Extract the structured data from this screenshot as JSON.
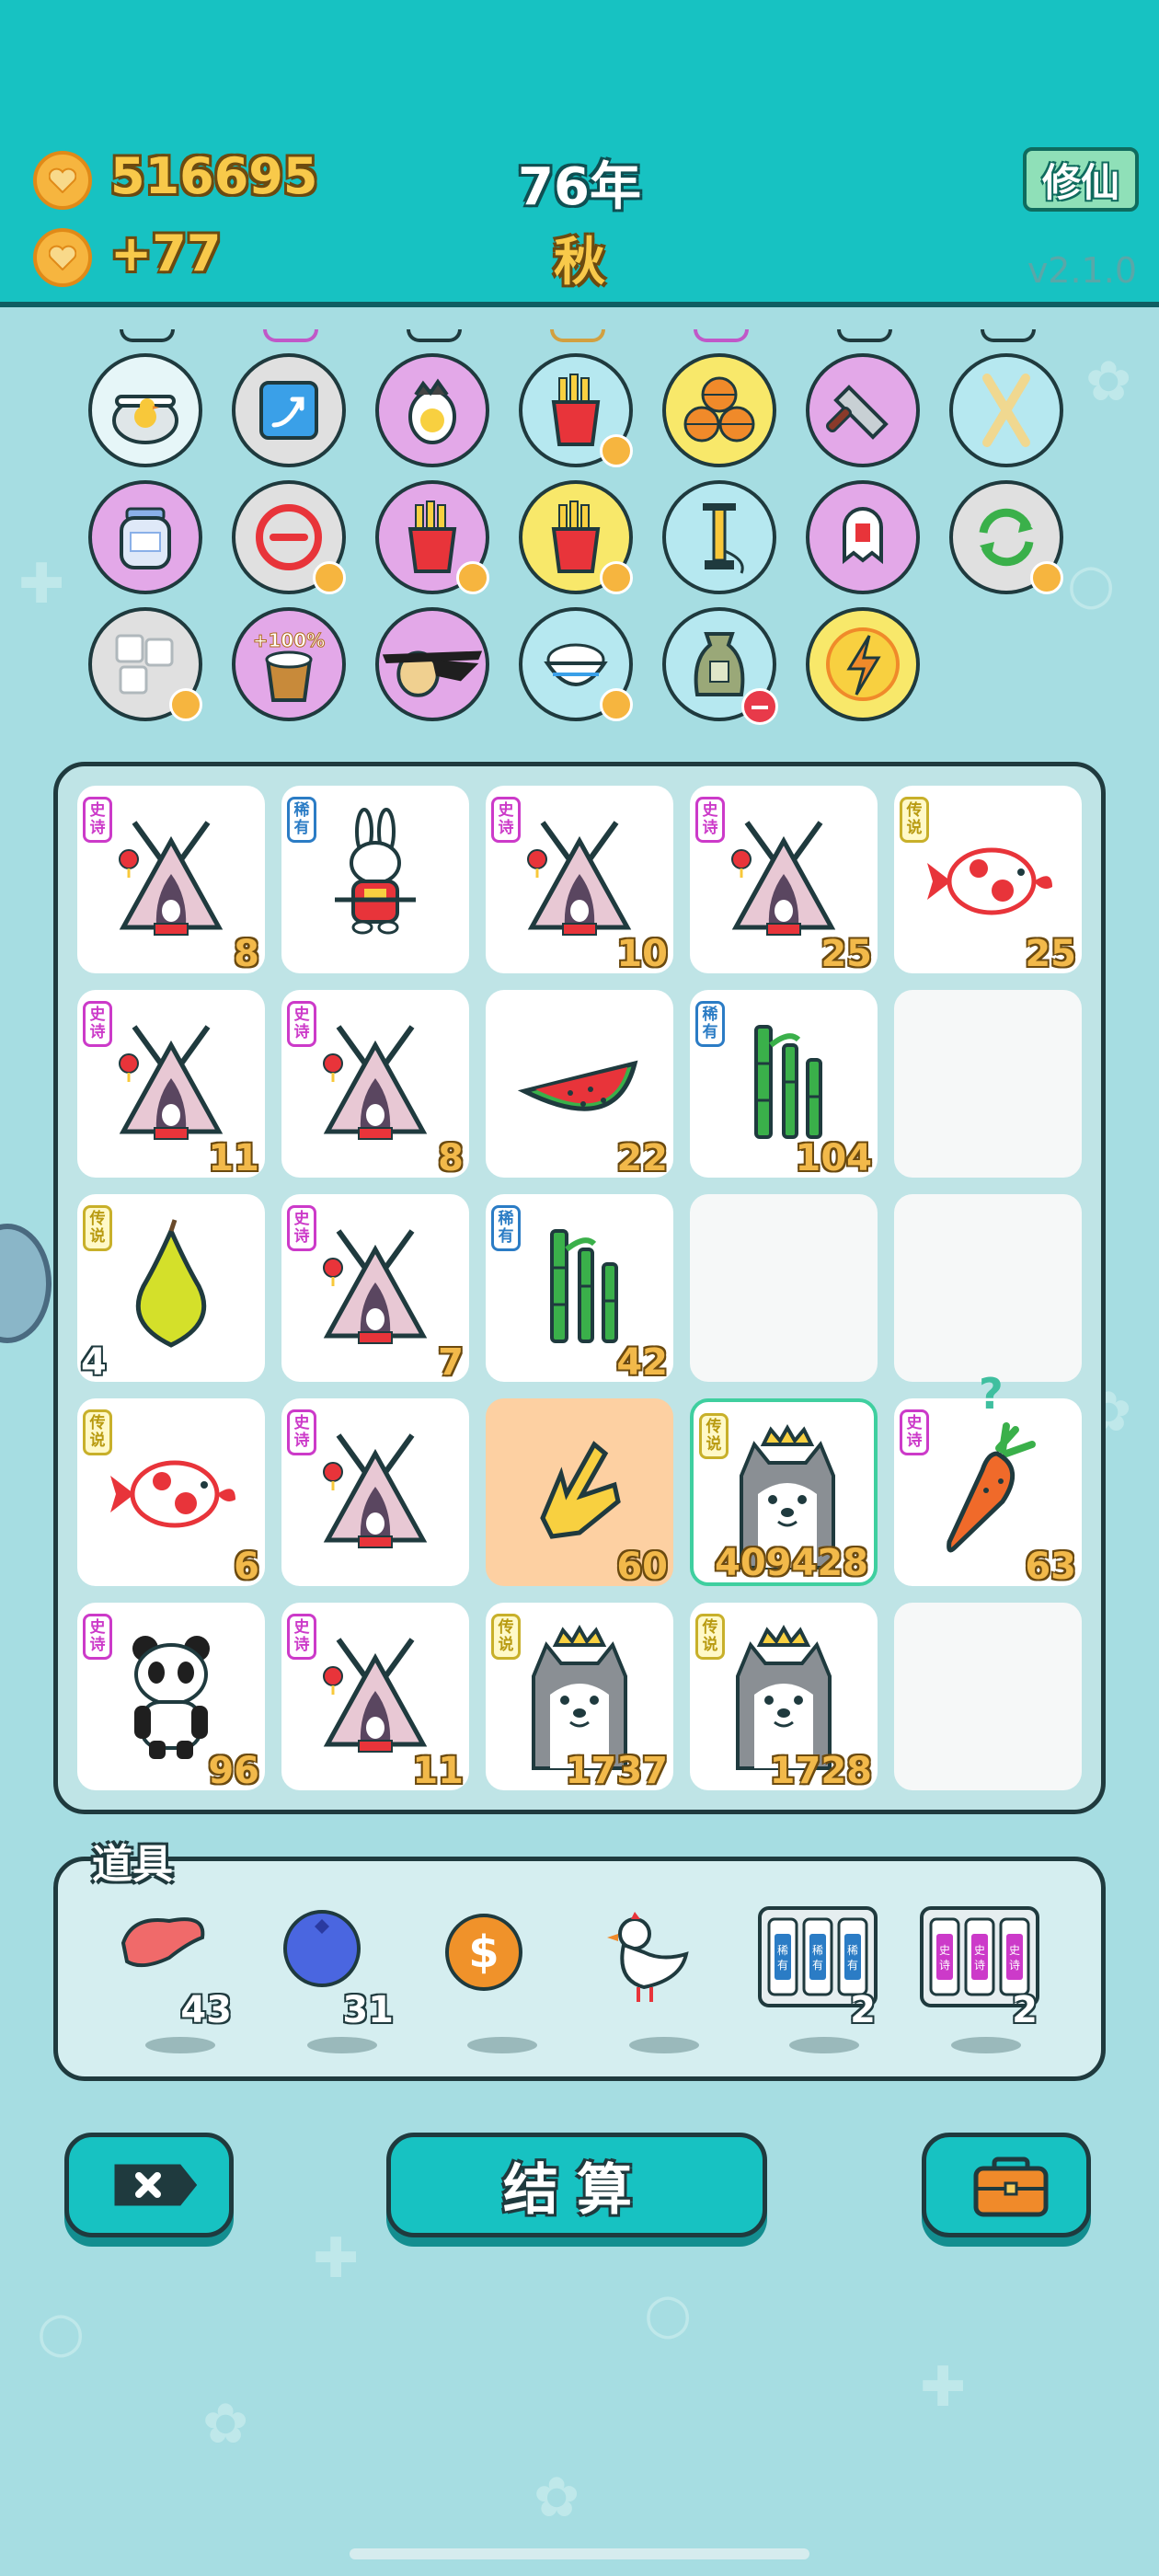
{
  "header": {
    "coins": "516695",
    "income": "+77",
    "year": "76年",
    "season": "秋",
    "mode_button": "修仙",
    "version": "v2.1.0"
  },
  "items": [
    {
      "name": "duck-pot",
      "color": "#e6f6f8",
      "badge": false
    },
    {
      "name": "level-up-card",
      "color": "#e0e0e0",
      "badge": false
    },
    {
      "name": "egg",
      "color": "#e3a8e8",
      "badge": false
    },
    {
      "name": "fries",
      "color": "#b6e8f0",
      "badge": true
    },
    {
      "name": "basketballs",
      "color": "#f8e86a",
      "badge": false
    },
    {
      "name": "cleaver",
      "color": "#e3a8e8",
      "badge": false
    },
    {
      "name": "crossed-sticks",
      "color": "#b6e8f0",
      "badge": false
    },
    {
      "name": "honey-jar",
      "color": "#e3a8e8",
      "badge": false
    },
    {
      "name": "remove",
      "color": "#e0e0e0",
      "badge": true
    },
    {
      "name": "fries",
      "color": "#e3a8e8",
      "badge": true
    },
    {
      "name": "fries",
      "color": "#f8e86a",
      "badge": true
    },
    {
      "name": "pump",
      "color": "#b6e8f0",
      "badge": false
    },
    {
      "name": "ghost-card",
      "color": "#e3a8e8",
      "badge": false
    },
    {
      "name": "refresh",
      "color": "#e0e0e0",
      "badge": true
    },
    {
      "name": "sugar-cubes",
      "color": "#e0e0e0",
      "badge": true
    },
    {
      "name": "bucket-plus-100",
      "color": "#e3a8e8",
      "badge": false,
      "text": "+100%"
    },
    {
      "name": "pirate-egg",
      "color": "#e3a8e8",
      "badge": false
    },
    {
      "name": "rice-bowl",
      "color": "#b6e8f0",
      "badge": true
    },
    {
      "name": "sack",
      "color": "#b6e8f0",
      "badge": false,
      "minus": true
    },
    {
      "name": "lightning",
      "color": "#f8e86a",
      "badge": false
    }
  ],
  "grid": [
    [
      {
        "item": "tent",
        "rarity": "epic",
        "rarity_label": "史诗",
        "count": "8"
      },
      {
        "item": "rabbit",
        "rarity": "rare",
        "rarity_label": "稀有",
        "count": ""
      },
      {
        "item": "tent",
        "rarity": "epic",
        "rarity_label": "史诗",
        "count": "10"
      },
      {
        "item": "tent",
        "rarity": "epic",
        "rarity_label": "史诗",
        "count": "25"
      },
      {
        "item": "koi",
        "rarity": "legend",
        "rarity_label": "传说",
        "count": "25"
      }
    ],
    [
      {
        "item": "tent",
        "rarity": "epic",
        "rarity_label": "史诗",
        "count": "11"
      },
      {
        "item": "tent",
        "rarity": "epic",
        "rarity_label": "史诗",
        "count": "8"
      },
      {
        "item": "watermelon",
        "rarity": "",
        "rarity_label": "",
        "count": "22"
      },
      {
        "item": "bamboo",
        "rarity": "rare",
        "rarity_label": "稀有",
        "count": "104"
      },
      {
        "item": "",
        "rarity": "",
        "rarity_label": "",
        "count": ""
      }
    ],
    [
      {
        "item": "pear",
        "rarity": "legend",
        "rarity_label": "传说",
        "count": "4",
        "count_left": true
      },
      {
        "item": "tent",
        "rarity": "epic",
        "rarity_label": "史诗",
        "count": "7"
      },
      {
        "item": "bamboo",
        "rarity": "rare",
        "rarity_label": "稀有",
        "count": "42"
      },
      {
        "item": "",
        "rarity": "",
        "rarity_label": "",
        "count": ""
      },
      {
        "item": "",
        "rarity": "",
        "rarity_label": "",
        "count": ""
      }
    ],
    [
      {
        "item": "koi",
        "rarity": "legend",
        "rarity_label": "传说",
        "count": "6"
      },
      {
        "item": "tent",
        "rarity": "epic",
        "rarity_label": "史诗",
        "count": ""
      },
      {
        "item": "hand",
        "rarity": "",
        "rarity_label": "",
        "count": "60",
        "highlight": true
      },
      {
        "item": "husky",
        "rarity": "legend",
        "rarity_label": "传说",
        "count": "409428",
        "selected": true
      },
      {
        "item": "carrot",
        "rarity": "epic",
        "rarity_label": "史诗",
        "count": "63",
        "question": true
      }
    ],
    [
      {
        "item": "panda",
        "rarity": "epic",
        "rarity_label": "史诗",
        "count": "96"
      },
      {
        "item": "tent",
        "rarity": "epic",
        "rarity_label": "史诗",
        "count": "11"
      },
      {
        "item": "husky",
        "rarity": "legend",
        "rarity_label": "传说",
        "count": "1737"
      },
      {
        "item": "husky",
        "rarity": "legend",
        "rarity_label": "传说",
        "count": "1728"
      },
      {
        "item": "",
        "rarity": "",
        "rarity_label": "",
        "count": ""
      }
    ]
  ],
  "tools": {
    "title": "道具",
    "items": [
      {
        "name": "liver",
        "count": "43"
      },
      {
        "name": "blueberry",
        "count": "31"
      },
      {
        "name": "dollar-coin",
        "count": ""
      },
      {
        "name": "white-bird",
        "count": ""
      },
      {
        "name": "rare-cards",
        "count": "2",
        "label": "稀有"
      },
      {
        "name": "epic-cards",
        "count": "2",
        "label": "史诗"
      }
    ]
  },
  "buttons": {
    "settle": "结算"
  },
  "colors": {
    "header_bg": "#17c2c2",
    "page_bg": "#a6dde2",
    "gold": "#f2b94a",
    "epic": "#cc3ac9",
    "rare": "#2b7cc5",
    "legend": "#c8b02a"
  }
}
